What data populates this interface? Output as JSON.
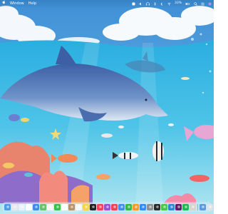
{
  "menubar": {
    "apple_icon": "apple-icon",
    "items": [
      "Window",
      "Help"
    ],
    "status": {
      "icons": [
        "app-menu-icon",
        "volume-icon",
        "headphones-icon",
        "bluetooth-icon",
        "focus-icon",
        "wifi-icon"
      ],
      "battery_percent": "33%",
      "extra_icons": [
        "battery-icon",
        "search-icon",
        "control-center-icon",
        "siri-icon"
      ]
    }
  },
  "wallpaper": {
    "description_icon": "underwater-dolphin-wallpaper",
    "colors": {
      "sky": "#4fa9e2",
      "water_top": "#36b8e0",
      "water_bottom": "#a8e2ef",
      "dolphin": "#5b7fb8"
    }
  },
  "dock": {
    "apps": [
      {
        "name": "finder-icon",
        "color": "#4a9fe8"
      },
      {
        "name": "launchpad-icon",
        "color": "#e8e8ee"
      },
      {
        "name": "safari-icon",
        "color": "#e9f2fb"
      },
      {
        "name": "chrome-icon",
        "color": "#ffffff"
      },
      {
        "name": "mail-icon",
        "color": "#3a8ee6"
      },
      {
        "name": "maps-icon",
        "color": "#6dc06b"
      },
      {
        "name": "photos-icon",
        "color": "#f5f5f5"
      },
      {
        "name": "facetime-icon",
        "color": "#36c24a"
      },
      {
        "name": "calendar-icon",
        "color": "#ffffff"
      },
      {
        "name": "contacts-icon",
        "color": "#b8926b"
      },
      {
        "name": "reminders-icon",
        "color": "#f7f7f7"
      },
      {
        "name": "notes-icon",
        "color": "#f7d54a"
      },
      {
        "name": "tv-icon",
        "color": "#222222"
      },
      {
        "name": "music-icon",
        "color": "#f2425a"
      },
      {
        "name": "podcasts-icon",
        "color": "#9b4fd6"
      },
      {
        "name": "news-icon",
        "color": "#f34256"
      },
      {
        "name": "keynote-icon",
        "color": "#3f8ef0"
      },
      {
        "name": "numbers-icon",
        "color": "#36b84d"
      },
      {
        "name": "pages-icon",
        "color": "#f59a2f"
      },
      {
        "name": "app-store-icon",
        "color": "#2f8cf2"
      },
      {
        "name": "system-settings-icon",
        "color": "#8e8e93"
      },
      {
        "name": "terminal-icon",
        "color": "#2b2b2b"
      },
      {
        "name": "messages-icon",
        "color": "#45c94b"
      },
      {
        "name": "vscode-icon",
        "color": "#2b88d8"
      },
      {
        "name": "slack-icon",
        "color": "#611f69"
      },
      {
        "name": "spotify-icon",
        "color": "#1db954"
      },
      {
        "name": "preview-icon",
        "color": "#d9d4c8"
      }
    ],
    "trailing": [
      {
        "name": "downloads-stack-icon",
        "color": "#5a9be0"
      },
      {
        "name": "trash-icon",
        "color": "#dfe4ea"
      }
    ]
  }
}
